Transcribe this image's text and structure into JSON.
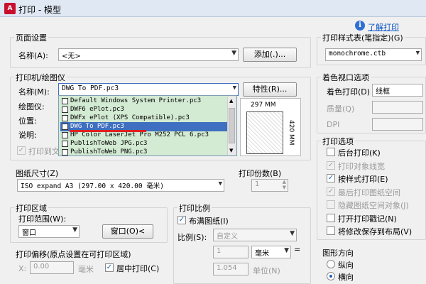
{
  "window": {
    "title": "打印 - 模型",
    "help_link": "了解打印",
    "logo": "A"
  },
  "page_setup": {
    "title": "页面设置",
    "name_label": "名称(A):",
    "name_value": "<无>",
    "add_button": "添加(.)..."
  },
  "printer": {
    "title": "打印机/绘图仪",
    "name_label": "名称(M):",
    "name_value": "DWG To PDF.pc3",
    "properties_button": "特性(R)...",
    "plotter_label": "绘图仪:",
    "location_label": "位置:",
    "description_label": "说明:",
    "print_to_file_label": "打印到文",
    "dropdown_items": [
      "Default Windows System Printer.pc3",
      "DWF6 ePlot.pc3",
      "DWFx ePlot (XPS Compatible).pc3",
      "DWG To PDF.pc3",
      "HP Color LaserJet Pro M252 PCL 6.pc3",
      "PublishToWeb JPG.pc3",
      "PublishToWeb PNG.pc3"
    ],
    "selected_index": 3,
    "preview_width": "297 MM",
    "preview_height": "420 MM"
  },
  "paper_size": {
    "title": "图纸尺寸(Z)",
    "value": "ISO expand A3 (297.00 x 420.00 毫米)"
  },
  "copies": {
    "title": "打印份数(B)",
    "value": "1"
  },
  "plot_area": {
    "title": "打印区域",
    "range_label": "打印范围(W):",
    "range_value": "窗口",
    "window_button": "窗口(O)<"
  },
  "plot_scale": {
    "title": "打印比例",
    "fit_label": "布满图纸(I)",
    "fit_checked": true,
    "scale_label": "比例(S):",
    "scale_value": "自定义",
    "value1": "1",
    "unit_value": "毫米",
    "value2": "1.054",
    "unit_label": "单位(N)"
  },
  "plot_offset": {
    "title": "打印偏移(原点设置在可打印区域)",
    "x_label": "X:",
    "x_value": "0.00",
    "x_unit": "毫米",
    "center_label": "居中打印(C)",
    "center_checked": true
  },
  "plot_style_table": {
    "title": "打印样式表(笔指定)(G)",
    "value": "monochrome.ctb"
  },
  "shaded_viewport": {
    "title": "着色视口选项",
    "shade_label": "着色打印(D)",
    "shade_value": "线框",
    "quality_label": "质量(Q)",
    "dpi_label": "DPI"
  },
  "plot_options": {
    "title": "打印选项",
    "items": [
      {
        "label": "后台打印(K)",
        "checked": false,
        "disabled": false
      },
      {
        "label": "打印对象线宽",
        "checked": true,
        "disabled": true
      },
      {
        "label": "按样式打印(E)",
        "checked": true,
        "disabled": false
      },
      {
        "label": "最后打印图纸空间",
        "checked": true,
        "disabled": true
      },
      {
        "label": "隐藏图纸空间对象(J)",
        "checked": false,
        "disabled": true
      },
      {
        "label": "打开打印戳记(N)",
        "checked": false,
        "disabled": false
      },
      {
        "label": "将修改保存到布局(V)",
        "checked": false,
        "disabled": false
      }
    ]
  },
  "orientation": {
    "title": "图形方向",
    "portrait_label": "纵向",
    "landscape_label": "横向",
    "selected": "landscape"
  }
}
